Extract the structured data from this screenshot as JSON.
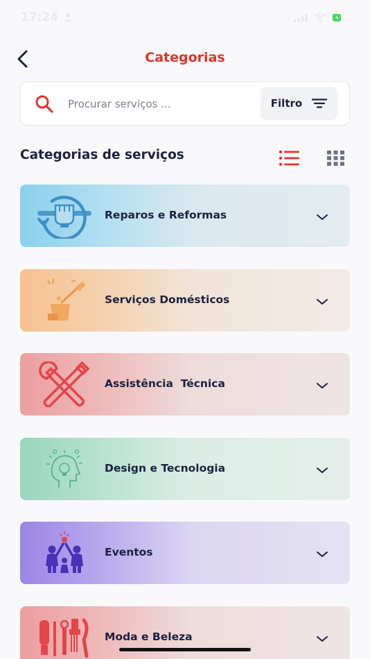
{
  "status_bar": {
    "time": "17:24"
  },
  "header": {
    "title": "Categorias"
  },
  "search": {
    "placeholder": "Procurar serviços ...",
    "value": "",
    "filter_label": "Filtro"
  },
  "section": {
    "title": "Categorias de serviços",
    "active_view": "list"
  },
  "categories": [
    {
      "label": "Reparos e Reformas",
      "icon": "repair-fist-wrench-icon",
      "accent": "#5bb8e0"
    },
    {
      "label": "Serviços Domésticos",
      "icon": "cleaning-bucket-icon",
      "accent": "#f0a860"
    },
    {
      "label": "Assistência  Técnica",
      "icon": "tools-crossed-icon",
      "accent": "#e2454a"
    },
    {
      "label": "Design e Tecnologia",
      "icon": "head-lightbulb-icon",
      "accent": "#4fb48e"
    },
    {
      "label": "Eventos",
      "icon": "people-celebration-icon",
      "accent": "#5a3cc8"
    },
    {
      "label": "Moda e Beleza",
      "icon": "barber-tools-icon",
      "accent": "#e2454a"
    }
  ],
  "colors": {
    "accent": "#e2332b",
    "text": "#1b2140",
    "background": "#f9f9fb"
  }
}
